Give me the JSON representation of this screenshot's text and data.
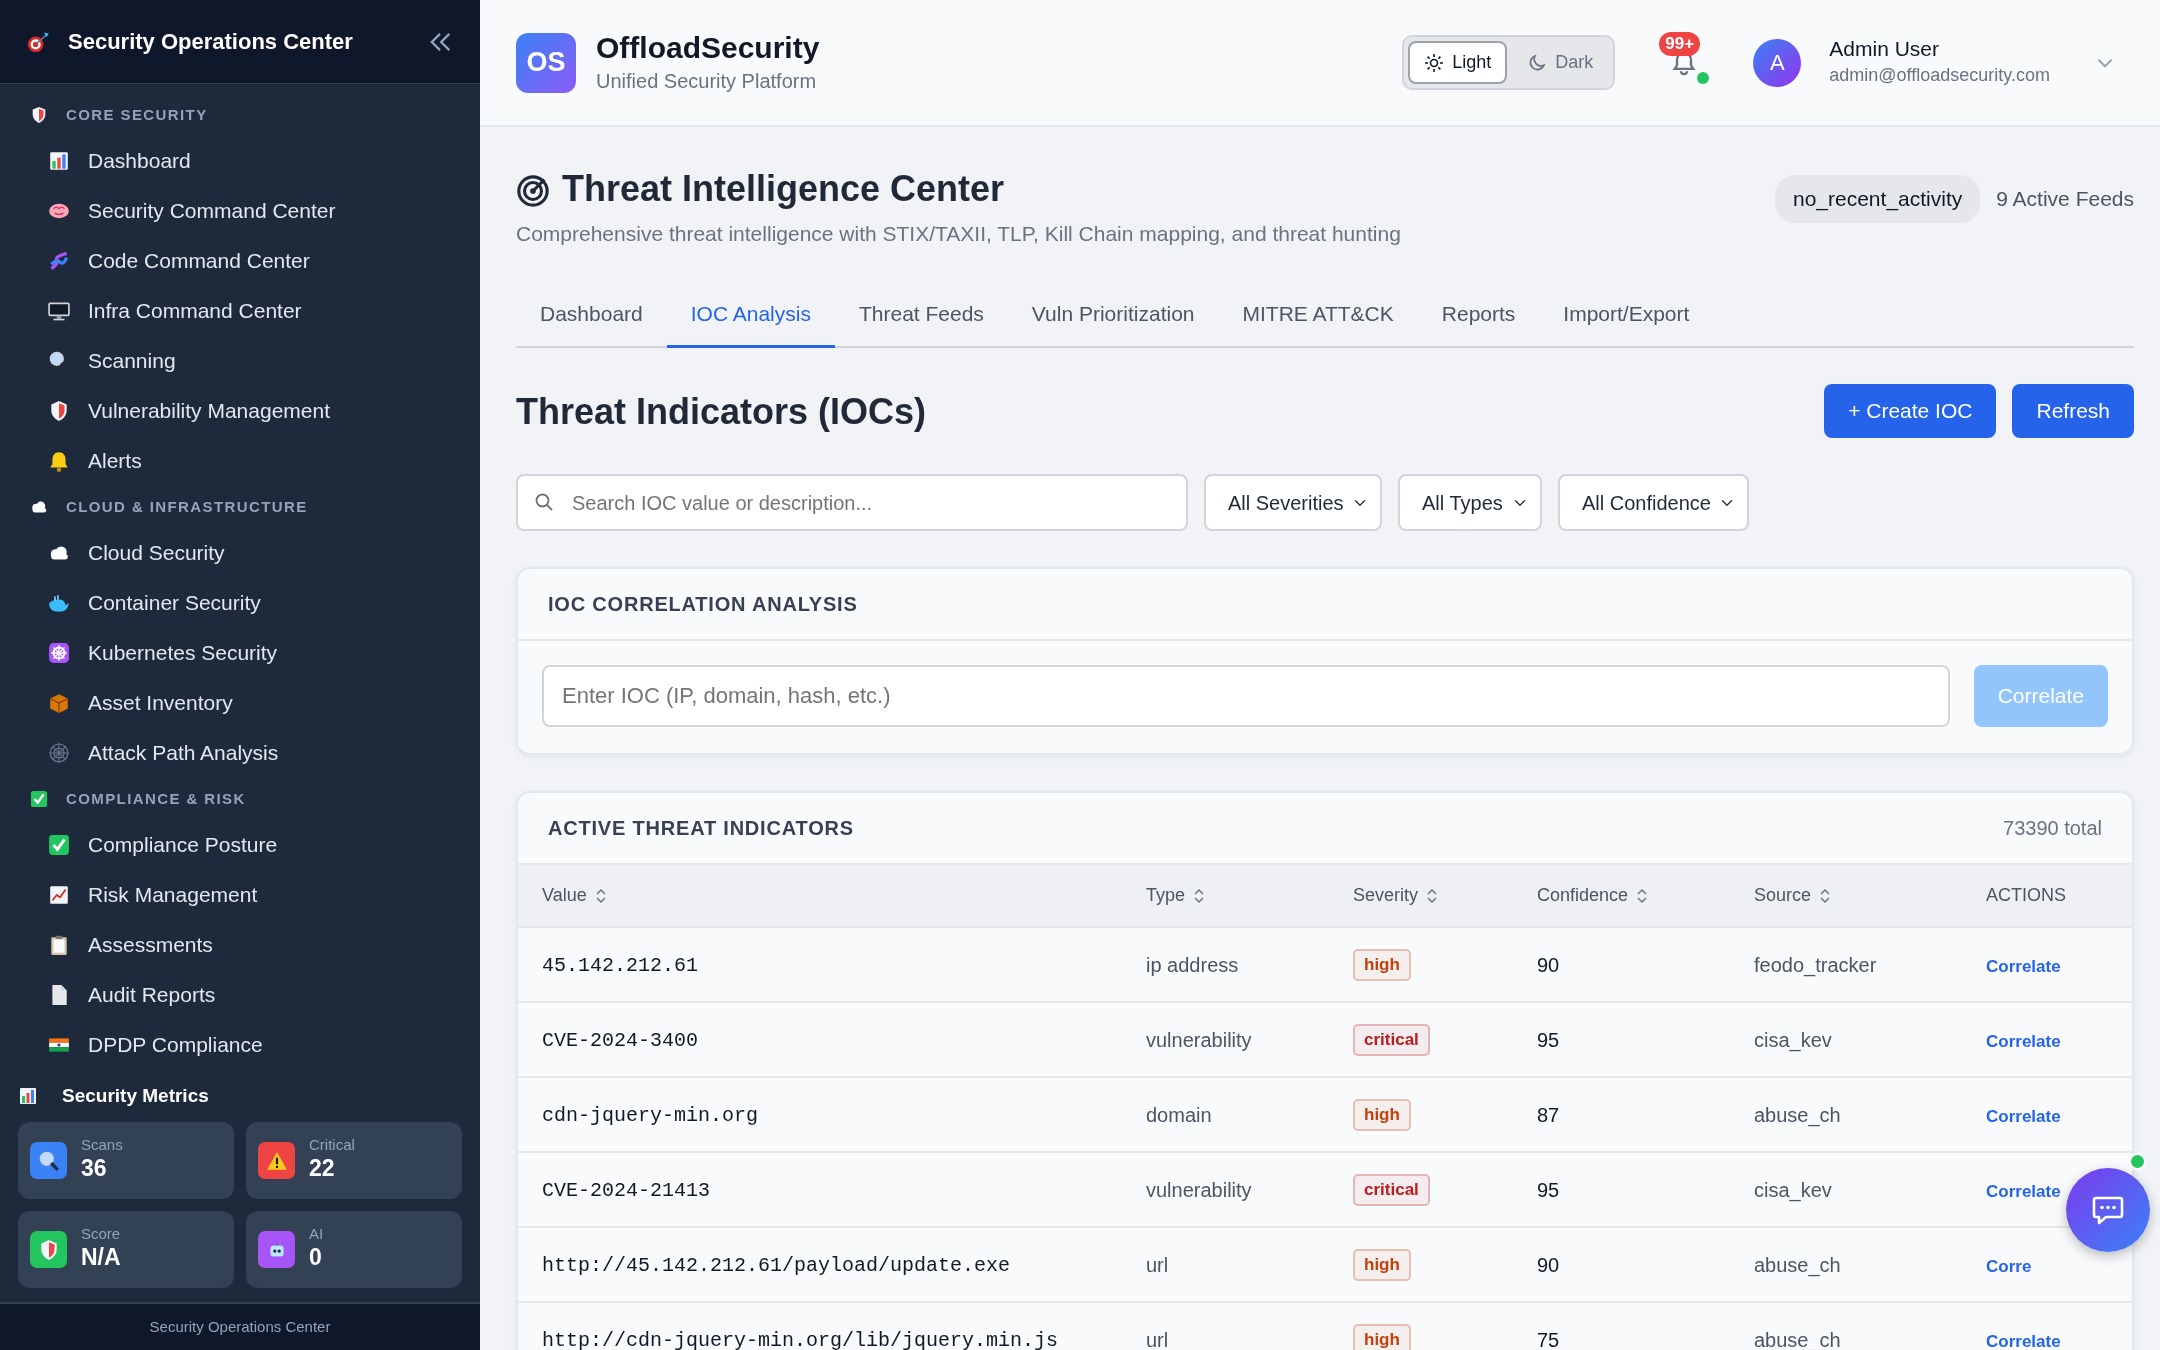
{
  "sidebar": {
    "title": "Security Operations Center",
    "sections": [
      {
        "label": "CORE SECURITY",
        "items": [
          {
            "label": "Dashboard"
          },
          {
            "label": "Security Command Center"
          },
          {
            "label": "Code Command Center"
          },
          {
            "label": "Infra Command Center"
          },
          {
            "label": "Scanning"
          },
          {
            "label": "Vulnerability Management"
          },
          {
            "label": "Alerts"
          }
        ]
      },
      {
        "label": "CLOUD & INFRASTRUCTURE",
        "items": [
          {
            "label": "Cloud Security"
          },
          {
            "label": "Container Security"
          },
          {
            "label": "Kubernetes Security"
          },
          {
            "label": "Asset Inventory"
          },
          {
            "label": "Attack Path Analysis"
          }
        ]
      },
      {
        "label": "COMPLIANCE & RISK",
        "items": [
          {
            "label": "Compliance Posture"
          },
          {
            "label": "Risk Management"
          },
          {
            "label": "Assessments"
          },
          {
            "label": "Audit Reports"
          },
          {
            "label": "DPDP Compliance"
          }
        ]
      }
    ],
    "metrics": {
      "title": "Security Metrics",
      "cards": [
        {
          "label": "Scans",
          "value": "36",
          "color": "#3b82f6"
        },
        {
          "label": "Critical",
          "value": "22",
          "color": "#ef4444"
        },
        {
          "label": "Score",
          "value": "N/A",
          "color": "#22c55e"
        },
        {
          "label": "AI",
          "value": "0",
          "color": "#a855f7"
        }
      ]
    },
    "footer": "Security Operations Center"
  },
  "header": {
    "logo": "OS",
    "brand": "OffloadSecurity",
    "tagline": "Unified Security Platform",
    "theme_options": [
      {
        "label": "Light",
        "selected": true
      },
      {
        "label": "Dark",
        "selected": false
      }
    ],
    "notification_badge": "99+",
    "user": {
      "initial": "A",
      "name": "Admin User",
      "email": "admin@offloadsecurity.com"
    }
  },
  "page": {
    "title": "Threat Intelligence Center",
    "subtitle": "Comprehensive threat intelligence with STIX/TAXII, TLP, Kill Chain mapping, and threat hunting",
    "status_pill": "no_recent_activity",
    "feeds": "9 Active Feeds"
  },
  "tabs": [
    {
      "label": "Dashboard",
      "selected": false
    },
    {
      "label": "IOC Analysis",
      "selected": true
    },
    {
      "label": "Threat Feeds",
      "selected": false
    },
    {
      "label": "Vuln Prioritization",
      "selected": false
    },
    {
      "label": "MITRE ATT&CK",
      "selected": false
    },
    {
      "label": "Reports",
      "selected": false
    },
    {
      "label": "Import/Export",
      "selected": false
    }
  ],
  "section_title": "Threat Indicators (IOCs)",
  "buttons": [
    "+ Create IOC",
    "Refresh"
  ],
  "search": {
    "placeholder": "Search IOC value or description..."
  },
  "filters": [
    "All Severities",
    "All Types",
    "All Confidence"
  ],
  "correlation": {
    "title": "IOC CORRELATION ANALYSIS",
    "placeholder": "Enter IOC (IP, domain, hash, etc.)",
    "button": {
      "label": "Correlate",
      "disabled": true
    }
  },
  "indicators": {
    "title": "ACTIVE THREAT INDICATORS",
    "total": "73390 total",
    "columns": [
      {
        "label": "Value",
        "sortable": true
      },
      {
        "label": "Type",
        "sortable": true
      },
      {
        "label": "Severity",
        "sortable": true
      },
      {
        "label": "Confidence",
        "sortable": true
      },
      {
        "label": "Source",
        "sortable": true
      },
      {
        "label": "ACTIONS",
        "sortable": false
      }
    ],
    "rows": [
      {
        "value": "45.142.212.61",
        "type": "ip address",
        "severity": {
          "text": "high",
          "color": "#c2410c"
        },
        "confidence": "90",
        "source": "feodo_tracker",
        "action": "Correlate"
      },
      {
        "value": "CVE-2024-3400",
        "type": "vulnerability",
        "severity": {
          "text": "critical",
          "color": "#b91c1c"
        },
        "confidence": "95",
        "source": "cisa_kev",
        "action": "Correlate"
      },
      {
        "value": "cdn-jquery-min.org",
        "type": "domain",
        "severity": {
          "text": "high",
          "color": "#c2410c"
        },
        "confidence": "87",
        "source": "abuse_ch",
        "action": "Correlate"
      },
      {
        "value": "CVE-2024-21413",
        "type": "vulnerability",
        "severity": {
          "text": "critical",
          "color": "#b91c1c"
        },
        "confidence": "95",
        "source": "cisa_kev",
        "action": "Correlate"
      },
      {
        "value": "http://45.142.212.61/payload/update.exe",
        "type": "url",
        "severity": {
          "text": "high",
          "color": "#c2410c"
        },
        "confidence": "90",
        "source": "abuse_ch",
        "action": "Corre"
      },
      {
        "value": "http://cdn-jquery-min.org/lib/jquery.min.js",
        "type": "url",
        "severity": {
          "text": "high",
          "color": "#c2410c"
        },
        "confidence": "75",
        "source": "abuse_ch",
        "action": "Correlate"
      }
    ]
  }
}
